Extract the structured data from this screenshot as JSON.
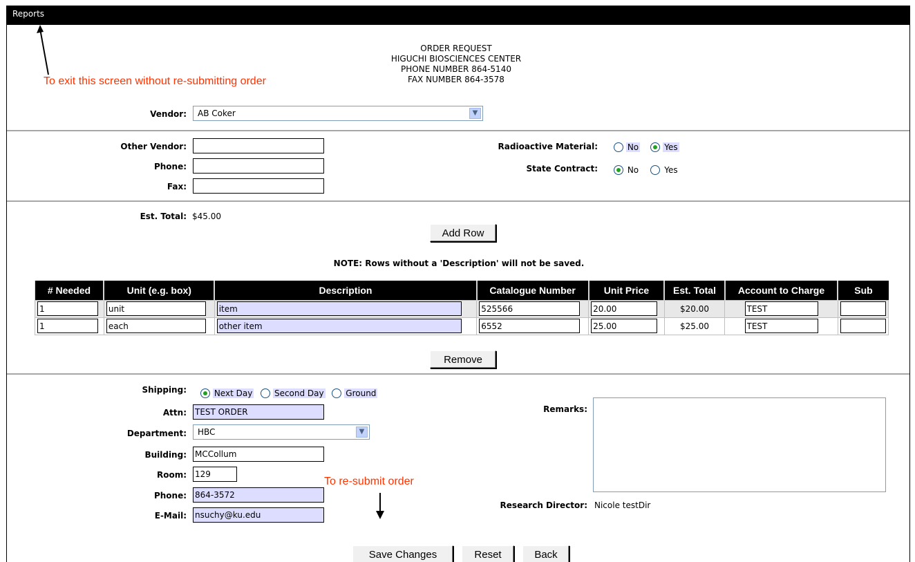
{
  "topbar": {
    "reports_link": "Reports"
  },
  "annotations": {
    "exit_note": "To exit this screen without re-submitting order",
    "resubmit_note": "To re-submit order"
  },
  "header": {
    "line1": "ORDER REQUEST",
    "line2": "HIGUCHI BIOSCIENCES CENTER",
    "line3": "PHONE NUMBER 864-5140",
    "line4": "FAX NUMBER 864-3578"
  },
  "vendor": {
    "label": "Vendor:",
    "value": "AB Coker"
  },
  "other_vendor": {
    "other_vendor_label": "Other Vendor:",
    "other_vendor_value": "",
    "phone_label": "Phone:",
    "phone_value": "",
    "fax_label": "Fax:",
    "fax_value": ""
  },
  "flags": {
    "radioactive_label": "Radioactive Material:",
    "state_contract_label": "State Contract:",
    "no": "No",
    "yes": "Yes",
    "radioactive_selected": "Yes",
    "state_contract_selected": "No"
  },
  "totals": {
    "label": "Est. Total:",
    "value": "$45.00"
  },
  "buttons": {
    "add_row": "Add Row",
    "remove": "Remove",
    "save": "Save Changes",
    "reset": "Reset",
    "back": "Back"
  },
  "note": "NOTE: Rows without a 'Description' will not be saved.",
  "table": {
    "headers": [
      "# Needed",
      "Unit (e.g. box)",
      "Description",
      "Catalogue Number",
      "Unit Price",
      "Est. Total",
      "Account to Charge",
      "Sub"
    ],
    "rows": [
      {
        "needed": "1",
        "unit": "unit",
        "description": "item",
        "catalogue": "525566",
        "price": "20.00",
        "total": "$20.00",
        "account": "TEST",
        "sub": ""
      },
      {
        "needed": "1",
        "unit": "each",
        "description": "other item",
        "catalogue": "6552",
        "price": "25.00",
        "total": "$25.00",
        "account": "TEST",
        "sub": ""
      }
    ]
  },
  "shipping": {
    "label": "Shipping:",
    "options": [
      "Next Day",
      "Second Day",
      "Ground"
    ],
    "selected": "Next Day"
  },
  "contact": {
    "attn_label": "Attn:",
    "attn_value": "TEST ORDER",
    "department_label": "Department:",
    "department_value": "HBC",
    "building_label": "Building:",
    "building_value": "MCCollum",
    "room_label": "Room:",
    "room_value": "129",
    "phone_label": "Phone:",
    "phone_value": "864-3572",
    "email_label": "E-Mail:",
    "email_value": "nsuchy@ku.edu"
  },
  "remarks": {
    "label": "Remarks:",
    "value": ""
  },
  "research_director": {
    "label": "Research Director:",
    "value": "Nicole testDir"
  },
  "colors": {
    "annotation": "#ff3300",
    "highlight": "#ddddff",
    "header_bg": "#000000"
  }
}
